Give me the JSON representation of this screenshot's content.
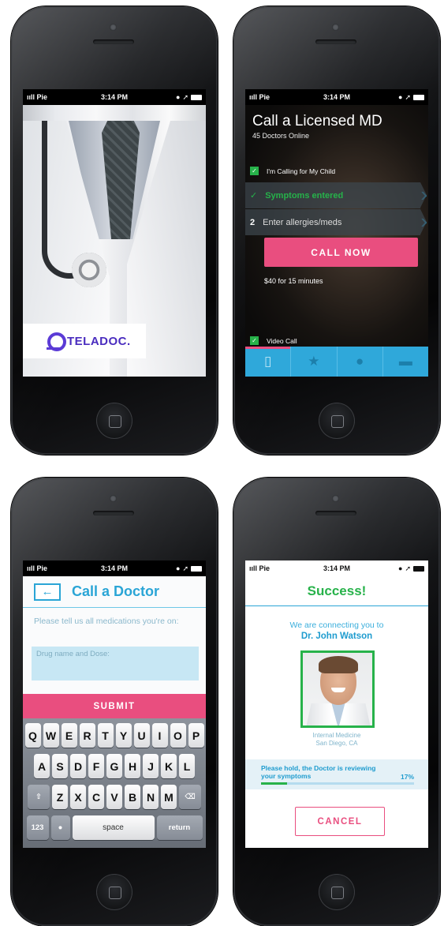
{
  "status_bar": {
    "carrier": "ııll Pie",
    "time": "3:14 PM",
    "icons": [
      "lock-rotation-icon",
      "location-arrow-icon",
      "clock-icon",
      "battery-icon"
    ]
  },
  "splash": {
    "brand": "TELADOC.",
    "brand_color": "#5b3bd6"
  },
  "call_md": {
    "title": "Call a Licensed MD",
    "doctors_online": "45 Doctors Online",
    "child_checkbox": {
      "label": "I'm Calling for My Child",
      "checked": true
    },
    "steps": [
      {
        "marker": "✓",
        "label": "Symptoms entered",
        "done": true
      },
      {
        "marker": "2",
        "label": "Enter allergies/meds",
        "done": false
      }
    ],
    "call_button": "CALL NOW",
    "price": "$40 for 15 minutes",
    "video_checkbox": {
      "label": "Video Call",
      "checked": true
    },
    "tabs": [
      {
        "icon": "phone-icon",
        "glyph": "▯",
        "active": true
      },
      {
        "icon": "star-icon",
        "glyph": "★",
        "active": false
      },
      {
        "icon": "person-icon",
        "glyph": "●",
        "active": false
      },
      {
        "icon": "folder-icon",
        "glyph": "▬",
        "active": false
      }
    ]
  },
  "meds": {
    "back_icon": "←",
    "title": "Call a Doctor",
    "prompt": "Please tell us all medications you're on:",
    "input_placeholder": "Drug name and Dose:",
    "submit_button": "SUBMIT",
    "keyboard": {
      "row1": [
        "Q",
        "W",
        "E",
        "R",
        "T",
        "Y",
        "U",
        "I",
        "O",
        "P"
      ],
      "row2": [
        "A",
        "S",
        "D",
        "F",
        "G",
        "H",
        "J",
        "K",
        "L"
      ],
      "row3": [
        "Z",
        "X",
        "C",
        "V",
        "B",
        "N",
        "M"
      ],
      "shift": "⇧",
      "delete": "⌫",
      "numbers": "123",
      "mic": "🎙",
      "space": "space",
      "return": "return"
    }
  },
  "success": {
    "title": "Success!",
    "connecting_text": "We are connecting you to",
    "doctor_name": "Dr. John Watson",
    "specialty": "Internal Medicine",
    "location": "San Diego, CA",
    "hold_text": "Please hold, the Doctor is reviewing your symptoms",
    "progress_percent": 17,
    "progress_label": "17%",
    "cancel_button": "CANCEL"
  },
  "colors": {
    "accent_blue": "#2aa5d6",
    "accent_pink": "#e94e7f",
    "success_green": "#27b24a"
  }
}
